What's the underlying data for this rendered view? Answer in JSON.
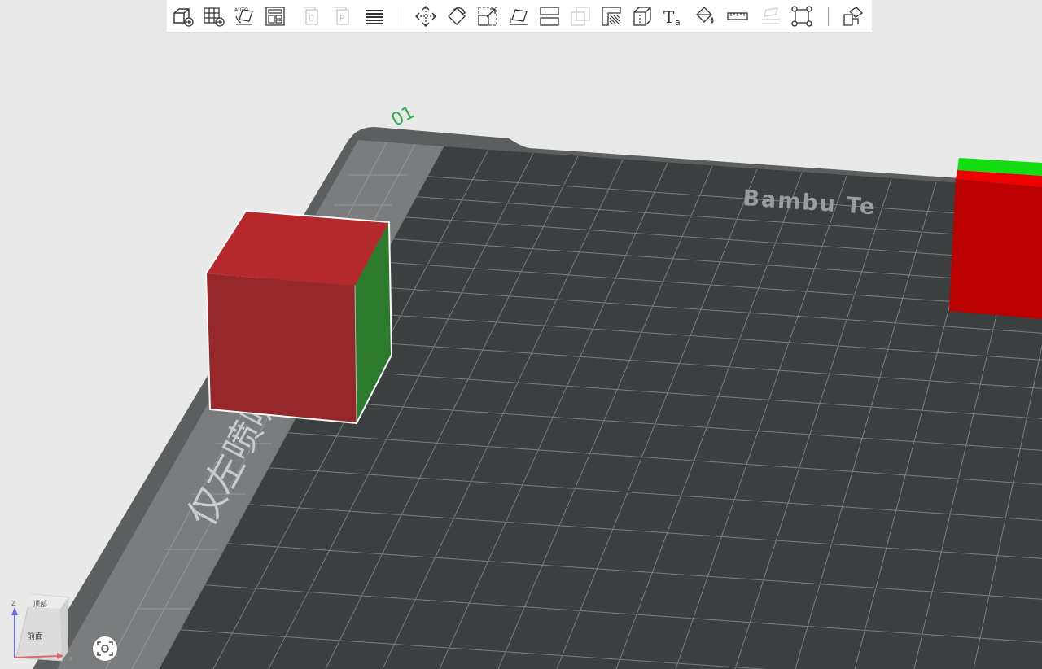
{
  "toolbar": {
    "items": [
      {
        "name": "add-object-icon"
      },
      {
        "name": "add-plate-icon"
      },
      {
        "name": "auto-orient-icon",
        "label": "AUTO"
      },
      {
        "name": "arrange-icon"
      },
      {
        "name": "split-objects-icon",
        "label": "0"
      },
      {
        "name": "split-parts-icon",
        "label": "P"
      },
      {
        "name": "layers-icon"
      },
      {
        "name": "move-icon"
      },
      {
        "name": "rotate-icon"
      },
      {
        "name": "scale-icon"
      },
      {
        "name": "lay-on-face-icon"
      },
      {
        "name": "cut-icon"
      },
      {
        "name": "boolean-icon"
      },
      {
        "name": "support-paint-icon"
      },
      {
        "name": "seam-paint-icon"
      },
      {
        "name": "text-icon",
        "label": "T",
        "sub": "a"
      },
      {
        "name": "color-paint-icon"
      },
      {
        "name": "measure-icon"
      },
      {
        "name": "assembly-icon"
      },
      {
        "name": "fit-view-icon"
      },
      {
        "name": "assemble-view-icon"
      }
    ]
  },
  "bed": {
    "brand_text": "Bambu Te",
    "side_text": "仅左喷嘴可",
    "plate_number": "01"
  },
  "view_cube": {
    "top_label": "顶部",
    "front_label": "前面",
    "axis_z": "Z",
    "axis_x": "X"
  },
  "colors": {
    "bed_dark": "#3c3f40",
    "bed_frame": "#5c5f60",
    "grid_line": "#8a8d8e",
    "cube_top": "#b5282b",
    "cube_front": "#96272a",
    "cube_side": "#2c7a2c",
    "accent_green": "#22cc22"
  }
}
